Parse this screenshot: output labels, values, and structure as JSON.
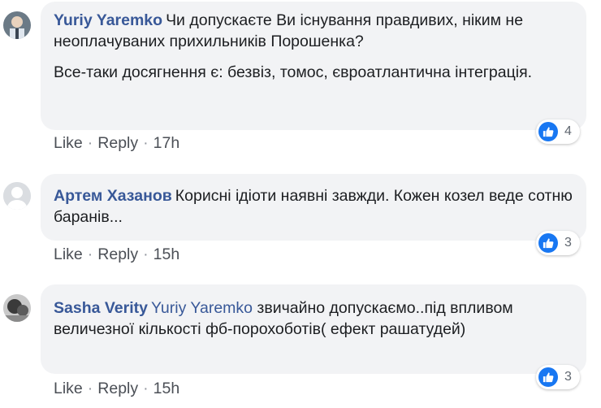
{
  "comments": [
    {
      "author": "Yuriy Yaremko",
      "paragraphs": [
        "Чи допускаєте Ви існування правдивих, ніким не неоплачуваних прихильників Порошенка?",
        "Все-таки досягнення є: безвіз, томос, євроатлантична інтеграція."
      ],
      "like_label": "Like",
      "reply_label": "Reply",
      "time": "17h",
      "reaction_count": "4",
      "reaction_icon": "like-icon"
    },
    {
      "author": "Артем Хазанов",
      "paragraphs": [
        "Корисні ідіоти наявні завжди. Кожен козел веде сотню баранів..."
      ],
      "like_label": "Like",
      "reply_label": "Reply",
      "time": "15h",
      "reaction_count": "3",
      "reaction_icon": "like-icon"
    },
    {
      "author": "Sasha Verity",
      "mention": "Yuriy Yaremko",
      "paragraphs": [
        "звичайно допускаємо..під впливом величезної кількості фб-порохоботів( ефект рашатудей)"
      ],
      "like_label": "Like",
      "reply_label": "Reply",
      "time": "15h",
      "reaction_count": "3",
      "reaction_icon": "like-icon"
    }
  ],
  "colors": {
    "author": "#385898",
    "bubble": "#f2f3f5",
    "like_badge": "#1877f2",
    "meta": "#606770"
  }
}
